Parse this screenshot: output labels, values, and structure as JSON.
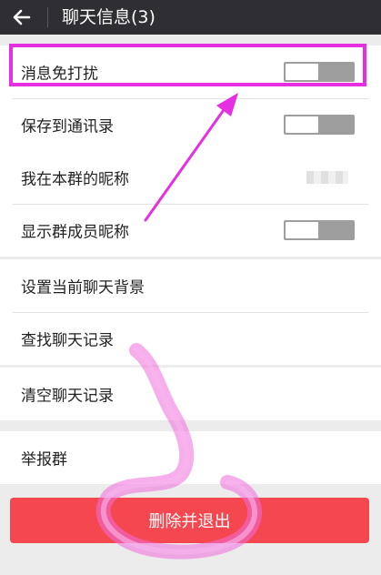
{
  "header": {
    "title": "聊天信息(3)",
    "back_icon": "arrow-left-icon"
  },
  "settings": {
    "mute": {
      "label": "消息免打扰",
      "enabled": false
    },
    "save_contacts": {
      "label": "保存到通讯录",
      "enabled": false
    },
    "my_nickname": {
      "label": "我在本群的昵称"
    },
    "show_nicknames": {
      "label": "显示群成员昵称",
      "enabled": false
    },
    "set_background": {
      "label": "设置当前聊天背景"
    },
    "search_history": {
      "label": "查找聊天记录"
    },
    "clear_history": {
      "label": "清空聊天记录"
    },
    "report": {
      "label": "举报群"
    }
  },
  "footer": {
    "exit_button": "删除并退出"
  },
  "colors": {
    "header_bg": "#2f2f33",
    "page_bg": "#ececec",
    "toggle_off": "#9e9e9e",
    "danger": "#f4474f",
    "annotation": "#e62fe0"
  }
}
